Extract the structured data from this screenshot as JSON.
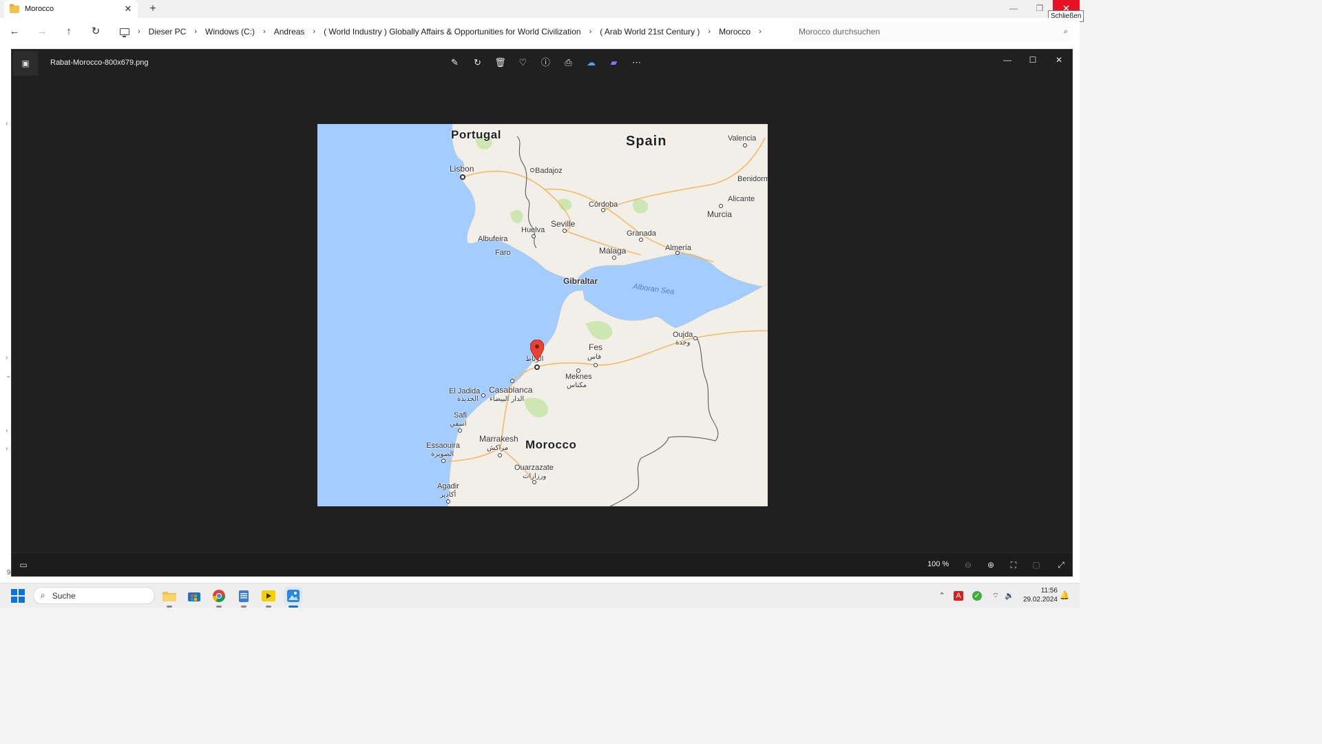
{
  "explorer": {
    "tab_title": "Morocco",
    "tab_close": "✕",
    "new_tab": "+",
    "tooltip_close": "Schließen",
    "breadcrumb": [
      "Dieser PC",
      "Windows (C:)",
      "Andreas",
      "( World Industry ) Globally Affairs & Opportunities for World Civilization",
      "( Arab World 21st Century )",
      "Morocco"
    ],
    "search_placeholder": "Morocco durchsuchen",
    "status_partial": "9"
  },
  "viewer": {
    "filename": "Rabat-Morocco-800x679.png",
    "toolbar": [
      {
        "name": "edit-image-icon",
        "glyph": "✎"
      },
      {
        "name": "rotate-icon",
        "glyph": "↻"
      },
      {
        "name": "delete-icon",
        "glyph": "🗑"
      },
      {
        "name": "favorite-icon",
        "glyph": "♡"
      },
      {
        "name": "info-icon",
        "glyph": "ⓘ"
      },
      {
        "name": "print-icon",
        "glyph": "⎙"
      },
      {
        "name": "onedrive-icon",
        "glyph": "☁"
      },
      {
        "name": "clipchamp-icon",
        "glyph": "▰"
      },
      {
        "name": "more-icon",
        "glyph": "⋯"
      }
    ],
    "zoom_level": "100 %"
  },
  "map": {
    "countries": {
      "portugal": "Portugal",
      "spain": "Spain",
      "morocco": "Morocco"
    },
    "cities": {
      "lisbon": "Lisbon",
      "badajoz": "Badajoz",
      "valencia": "Valencia",
      "benidorm": "Benidorm",
      "alicante": "Alicante",
      "cordoba": "Córdoba",
      "murcia": "Murcia",
      "huelva": "Huelva",
      "seville": "Seville",
      "granada": "Granada",
      "albufeira": "Albufeira",
      "faro": "Faro",
      "malaga": "Málaga",
      "almeria": "Almería",
      "gibraltar": "Gibraltar",
      "oujda": "Oujda",
      "oujda_ar": "وجدة",
      "rabat_ar": "الرباط",
      "fes": "Fes",
      "fes_ar": "فاس",
      "meknes": "Meknes",
      "meknes_ar": "مكناس",
      "el_jadida": "El Jadida",
      "el_jadida_ar": "الجديدة",
      "casablanca": "Casablanca",
      "casablanca_ar": "الدار البيضاء",
      "safi": "Safi",
      "safi_ar": "اسفي",
      "marrakesh": "Marrakesh",
      "marrakesh_ar": "مراكش",
      "essaouira": "Essaouira",
      "essaouira_ar": "الصويرة",
      "ouarzazate": "Ouarzazate",
      "ouarzazate_ar": "ورزازات",
      "agadir": "Agadir",
      "agadir_ar": "أكادير"
    },
    "sea": "Alboran Sea"
  },
  "taskbar": {
    "search_label": "Suche",
    "time": "11:56",
    "date": "29.02.2024"
  },
  "colors": {
    "sea": "#a3ccff",
    "land": "#f2efe9",
    "close_red": "#e81123",
    "accent": "#0a74da"
  }
}
